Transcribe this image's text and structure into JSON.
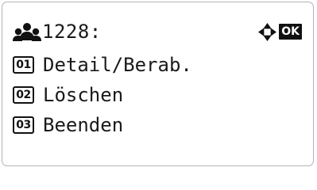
{
  "header": {
    "title": "1228:",
    "users_icon": "users-icon",
    "nav_icon": "four-way-arrow-icon",
    "ok_label": "OK"
  },
  "menu": {
    "items": [
      {
        "num": "01",
        "label": "Detail/Berab."
      },
      {
        "num": "02",
        "label": "Löschen"
      },
      {
        "num": "03",
        "label": "Beenden"
      }
    ]
  },
  "colors": {
    "text": "#1a1a1a",
    "border": "#b3b3b3",
    "badge_bg": "#111111"
  }
}
